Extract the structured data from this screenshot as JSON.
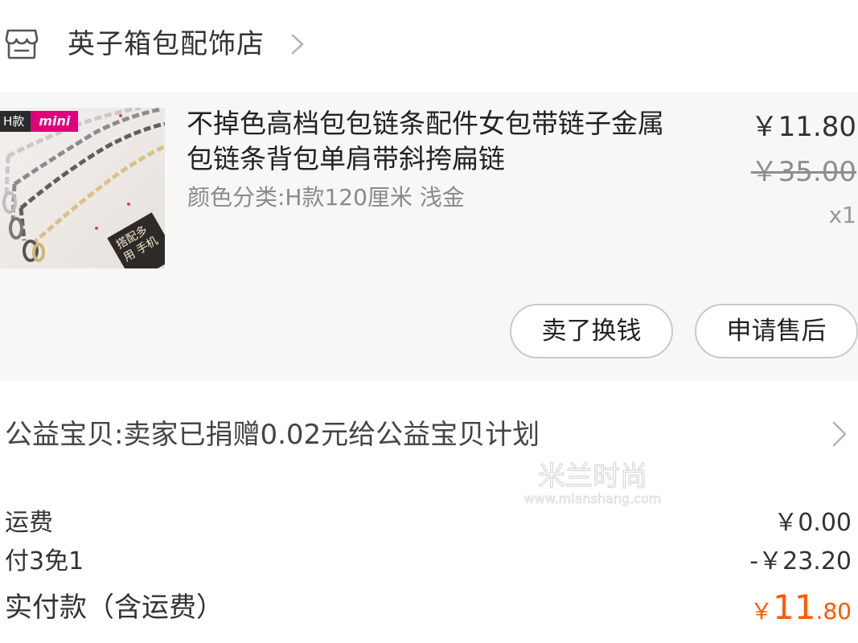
{
  "shop": {
    "name": "英子箱包配饰店",
    "icon": "store-icon",
    "chevron_icon": "chevron-right-icon"
  },
  "item": {
    "thumbnail": {
      "badge_left": "H款",
      "badge_right": "mini",
      "sticker_text": "搭配多用 手机"
    },
    "title": "不掉色高档包包链条配件女包带链子金属包链条背包单肩带斜挎扁链",
    "spec": "颜色分类:H款120厘米 浅金",
    "price_now": "￥11.80",
    "price_original": "￥35.00",
    "quantity": "x1",
    "buttons": {
      "sell": "卖了换钱",
      "after_sale": "申请售后"
    }
  },
  "charity": {
    "text": "公益宝贝:卖家已捐赠0.02元给公益宝贝计划",
    "chevron_icon": "chevron-right-icon"
  },
  "watermark": {
    "line1": "米兰时尚",
    "line2": "www.mlanshang.com"
  },
  "summary": {
    "shipping_label": "运费",
    "shipping_value": "￥0.00",
    "promo_label": "付3免1",
    "promo_value": "-￥23.20",
    "total_label": "实付款（含运费）",
    "total_currency": "￥",
    "total_int": "11",
    "total_dec": ".80",
    "total_color": "#ff5a00"
  }
}
